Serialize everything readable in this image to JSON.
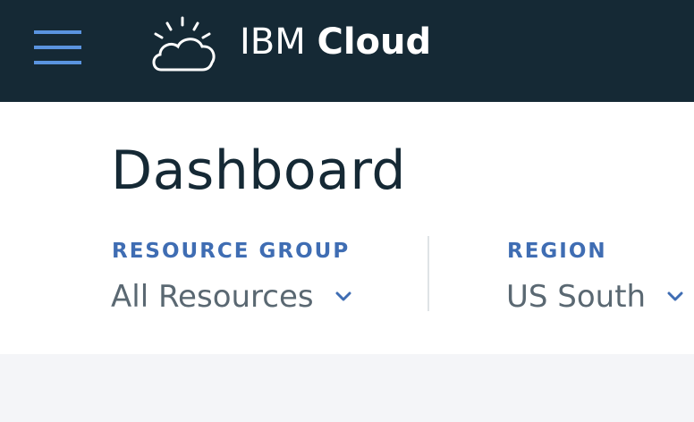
{
  "header": {
    "brand_light": "IBM",
    "brand_bold": "Cloud",
    "menu_icon": "hamburger-menu-icon",
    "logo_icon": "cloud-sun-icon",
    "background": "#152935",
    "menu_color": "#5a94e0"
  },
  "dashboard": {
    "title": "Dashboard",
    "filters": {
      "resource_group": {
        "label": "RESOURCE GROUP",
        "value": "All Resources",
        "icon": "chevron-down-icon"
      },
      "region": {
        "label": "REGION",
        "value": "US South",
        "icon": "chevron-down-icon"
      }
    },
    "label_color": "#3f6db3",
    "value_color": "#5a6872"
  }
}
